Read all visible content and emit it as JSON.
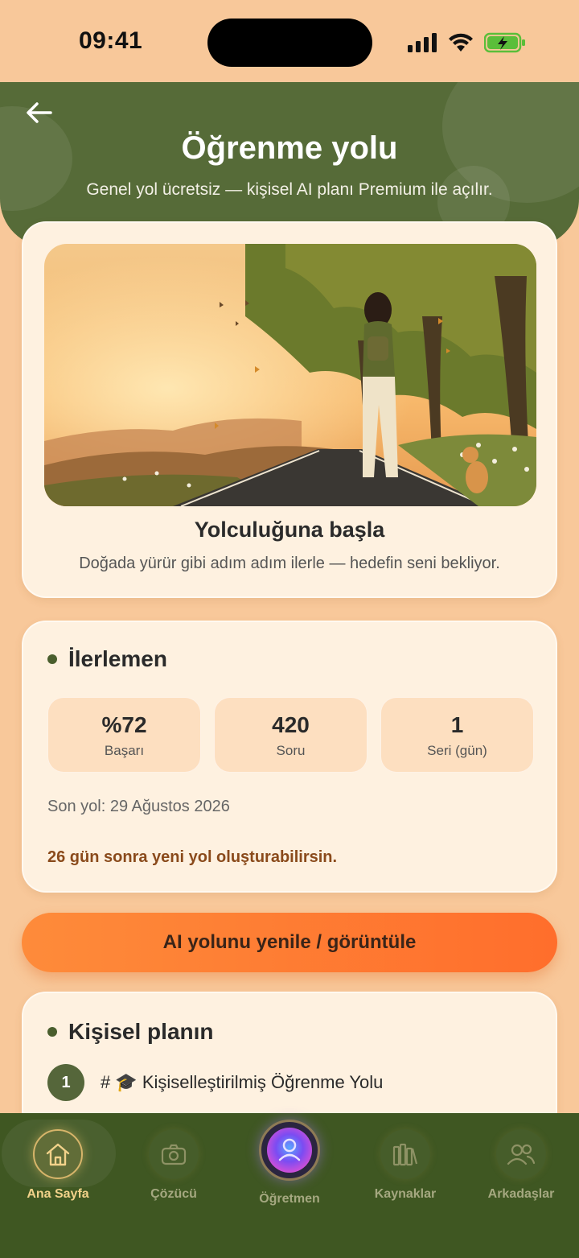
{
  "status_bar": {
    "time": "09:41"
  },
  "header": {
    "title": "Öğrenme yolu",
    "subtitle": "Genel yol ücretsiz — kişisel AI planı Premium ile açılır."
  },
  "hero": {
    "title": "Yolculuğuna başla",
    "subtitle": "Doğada yürür gibi adım adım ilerle — hedefin seni bekliyor."
  },
  "progress": {
    "title": "İlerlemen",
    "stats": [
      {
        "value": "%72",
        "label": "Başarı"
      },
      {
        "value": "420",
        "label": "Soru"
      },
      {
        "value": "1",
        "label": "Seri (gün)"
      }
    ],
    "last_path": "Son yol: 29 Ağustos 2026",
    "notice": "26 gün sonra yeni yol oluşturabilirsin."
  },
  "cta_label": "AI yolunu yenile / görüntüle",
  "plan": {
    "title": "Kişisel planın",
    "items": [
      {
        "number": "1",
        "text": "# 🎓 Kişiselleştirilmiş Öğrenme Yolu"
      }
    ]
  },
  "nav": {
    "items": [
      {
        "label": "Ana Sayfa",
        "icon": "home-icon",
        "active": true
      },
      {
        "label": "Çözücü",
        "icon": "camera-icon",
        "active": false
      },
      {
        "label": "Öğretmen",
        "icon": "teacher-avatar-icon",
        "active": false
      },
      {
        "label": "Kaynaklar",
        "icon": "books-icon",
        "active": false
      },
      {
        "label": "Arkadaşlar",
        "icon": "friends-icon",
        "active": false
      }
    ]
  },
  "colors": {
    "background": "#F8C89A",
    "header": "#566B38",
    "card": "#FEF1E0",
    "accent": "#FF7A33",
    "nav": "#3F5722",
    "notice": "#8A4A1B"
  }
}
